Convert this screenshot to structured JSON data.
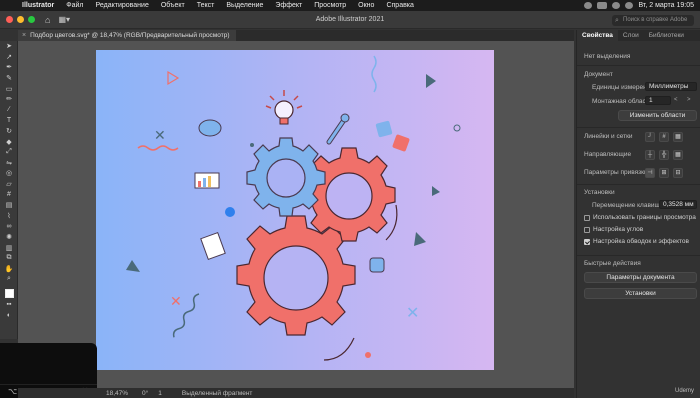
{
  "menubar": {
    "app_name": "Illustrator",
    "items": [
      "Файл",
      "Редактирование",
      "Объект",
      "Текст",
      "Выделение",
      "Эффект",
      "Просмотр",
      "Окно",
      "Справка"
    ],
    "datetime": "Вт, 2 марта  19:05"
  },
  "appbar": {
    "window_title": "Adobe Illustrator 2021",
    "search_placeholder": "Поиск в справке Adobe"
  },
  "document_tab": {
    "title": "Подбор цветов.svg* @ 18,47% (RGB/Предварительный просмотр)"
  },
  "toolbar": {
    "tools": [
      "selection-tool",
      "direct-selection-tool",
      "pen-tool",
      "curvature-tool",
      "rectangle-tool",
      "pencil-tool",
      "brush-tool",
      "type-tool",
      "rotate-tool",
      "eraser-tool",
      "scale-tool",
      "width-tool",
      "shape-builder-tool",
      "perspective-tool",
      "mesh-tool",
      "gradient-tool",
      "eyedropper-tool",
      "blend-tool",
      "symbol-sprayer-tool",
      "graph-tool",
      "artboard-tool",
      "slice-tool",
      "hand-tool",
      "zoom-tool"
    ]
  },
  "statusbar": {
    "zoom": "18,47%",
    "angle": "0°",
    "page": "1",
    "selection": "Выделенный фрагмент"
  },
  "panel": {
    "tabs": [
      "Свойства",
      "Слои",
      "Библиотеки"
    ],
    "no_selection": "Нет выделения",
    "document_header": "Документ",
    "units_label": "Единицы измерения:",
    "units_value": "Миллиметры",
    "artboard_label": "Монтажная область:",
    "artboard_value": "1",
    "edit_artboards_button": "Изменить области",
    "rulers_label": "Линейки и сетки",
    "guides_label": "Направляющие",
    "snap_label": "Параметры привязки",
    "preferences_header": "Установки",
    "key_increment_label": "Перемещение клавишами:",
    "key_increment_value": "0,3528 мм",
    "check_preview_bounds": "Использовать границы просмотра",
    "check_corners": "Настройка углов",
    "check_strokes": "Настройка обводок и эффектов",
    "check_preview_bounds_on": false,
    "check_corners_on": false,
    "check_strokes_on": true,
    "quick_actions_header": "Быстрые действия",
    "document_setup_button": "Параметры документа",
    "preferences_button": "Установки"
  },
  "watermark": "Udemy",
  "colors": {
    "gear_fill": "#f0706a",
    "gear_blue": "#7fb3ec",
    "gradient_left": "#8ab4f8",
    "gradient_right": "#d6b7f2",
    "accent_blue": "#2f80ed"
  }
}
